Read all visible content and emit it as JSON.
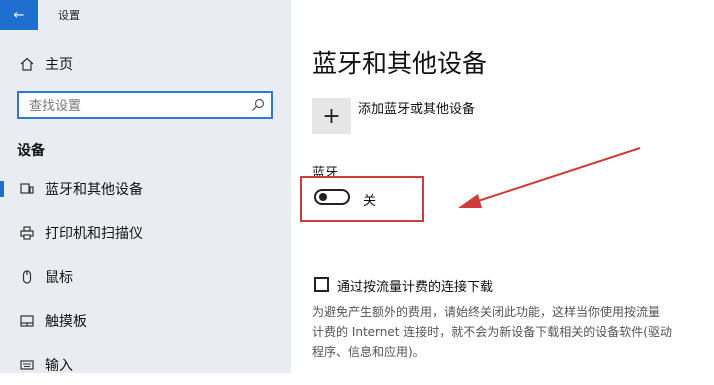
{
  "window": {
    "title": "设置",
    "back_icon": "back-arrow-icon"
  },
  "sidebar": {
    "home_label": "主页",
    "search_placeholder": "查找设置",
    "section_heading": "设备",
    "items": [
      {
        "label": "蓝牙和其他设备",
        "icon": "bluetooth-devices-icon",
        "active": true
      },
      {
        "label": "打印机和扫描仪",
        "icon": "printer-icon",
        "active": false
      },
      {
        "label": "鼠标",
        "icon": "mouse-icon",
        "active": false
      },
      {
        "label": "触摸板",
        "icon": "touchpad-icon",
        "active": false
      },
      {
        "label": "输入",
        "icon": "keyboard-icon",
        "active": false
      }
    ]
  },
  "main": {
    "page_title": "蓝牙和其他设备",
    "add_device_label": "添加蓝牙或其他设备",
    "bluetooth_label": "蓝牙",
    "bluetooth_state": "关",
    "bluetooth_on": false,
    "metered_label": "通过按流量计费的连接下载",
    "metered_checked": false,
    "metered_desc_line1": "为避免产生额外的费用，请始终关闭此功能，这样当你使用按流量",
    "metered_desc_line2": "计费的 Internet 连接时，就不会为新设备下载相关的设备软件(驱动",
    "metered_desc_line3": "程序、信息和应用)。"
  },
  "annotation": {
    "color": "#d23a3a"
  },
  "colors": {
    "accent": "#1f6fd0",
    "sidebar_bg": "#e9edf1"
  }
}
